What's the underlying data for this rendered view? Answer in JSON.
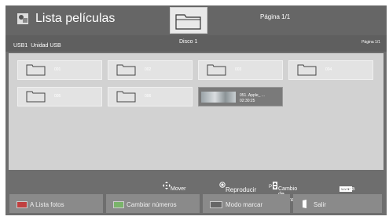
{
  "header": {
    "title": "Lista películas",
    "page_indicator": "Página 1/1"
  },
  "subbar": {
    "source": "USB1",
    "device": "Unidad USB",
    "disk": "Disco 1",
    "page": "Página 1/1"
  },
  "tiles": [
    {
      "type": "folder",
      "label": "001"
    },
    {
      "type": "folder",
      "label": "002"
    },
    {
      "type": "folder",
      "label": "003"
    },
    {
      "type": "folder",
      "label": "004"
    },
    {
      "type": "folder",
      "label": "005"
    },
    {
      "type": "folder",
      "label": "006"
    },
    {
      "type": "video",
      "title": "051. Apple_ ...",
      "duration": "02:30:25"
    }
  ],
  "help": {
    "move": "Mover",
    "play": "Reproducir",
    "page_change": "Cambio de página",
    "mark_badge": "MARK",
    "mark": "Marca"
  },
  "buttons": {
    "photo_list": "A Lista fotos",
    "change_numbers": "Cambiar números",
    "mark_mode": "Modo marcar",
    "exit": "Salir"
  },
  "colors": {
    "red_button": "#c04040",
    "green_button": "#7ab46a",
    "yellow_button": "#666666"
  }
}
